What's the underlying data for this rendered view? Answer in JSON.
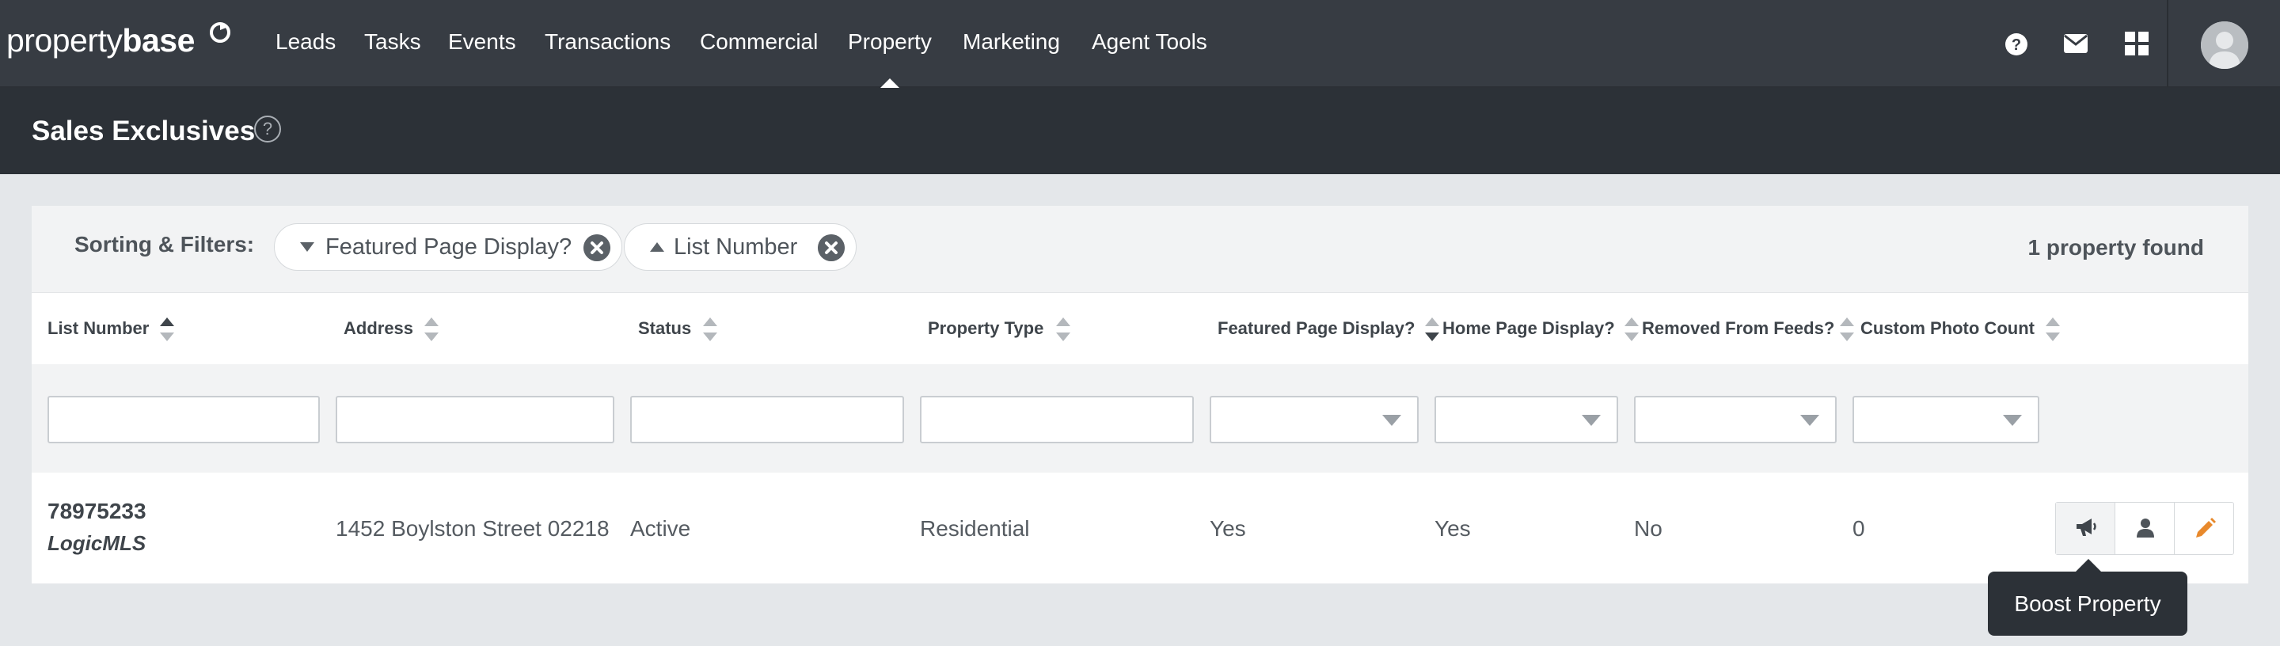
{
  "brand": {
    "logo_part1": "property",
    "logo_part2": "base"
  },
  "nav": {
    "items": [
      {
        "label": "Leads"
      },
      {
        "label": "Tasks"
      },
      {
        "label": "Events"
      },
      {
        "label": "Transactions"
      },
      {
        "label": "Commercial"
      },
      {
        "label": "Property",
        "active": true
      },
      {
        "label": "Marketing"
      },
      {
        "label": "Agent Tools"
      }
    ],
    "utility_icons": [
      "help-icon",
      "mail-icon",
      "apps-grid-icon"
    ]
  },
  "page": {
    "title": "Sales Exclusives",
    "help_glyph": "?"
  },
  "filters": {
    "label": "Sorting & Filters:",
    "chips": [
      {
        "label": "Featured Page Display?",
        "direction": "desc"
      },
      {
        "label": "List Number",
        "direction": "asc"
      }
    ],
    "result_count": "1 property found"
  },
  "table": {
    "columns": [
      {
        "label": "List Number",
        "sort": "asc"
      },
      {
        "label": "Address",
        "sort": "none"
      },
      {
        "label": "Status",
        "sort": "none"
      },
      {
        "label": "Property Type",
        "sort": "none"
      },
      {
        "label": "Featured Page Display?",
        "sort": "desc"
      },
      {
        "label": "Home Page Display?",
        "sort": "none"
      },
      {
        "label": "Removed From Feeds?",
        "sort": "none"
      },
      {
        "label": "Custom Photo Count",
        "sort": "none"
      }
    ],
    "rows": [
      {
        "list_number": "78975233",
        "source": "LogicMLS",
        "address": "1452 Boylston Street 02218",
        "status": "Active",
        "property_type": "Residential",
        "featured_page_display": "Yes",
        "home_page_display": "Yes",
        "removed_from_feeds": "No",
        "custom_photo_count": "0"
      }
    ],
    "row_actions": [
      "megaphone-icon",
      "person-icon",
      "pencil-icon"
    ]
  },
  "tooltip": {
    "text": "Boost Property"
  },
  "colors": {
    "nav_bg": "#373c43",
    "header_bg": "#2c3137",
    "page_bg": "#e4e7ea",
    "accent_edit": "#e8892c"
  }
}
